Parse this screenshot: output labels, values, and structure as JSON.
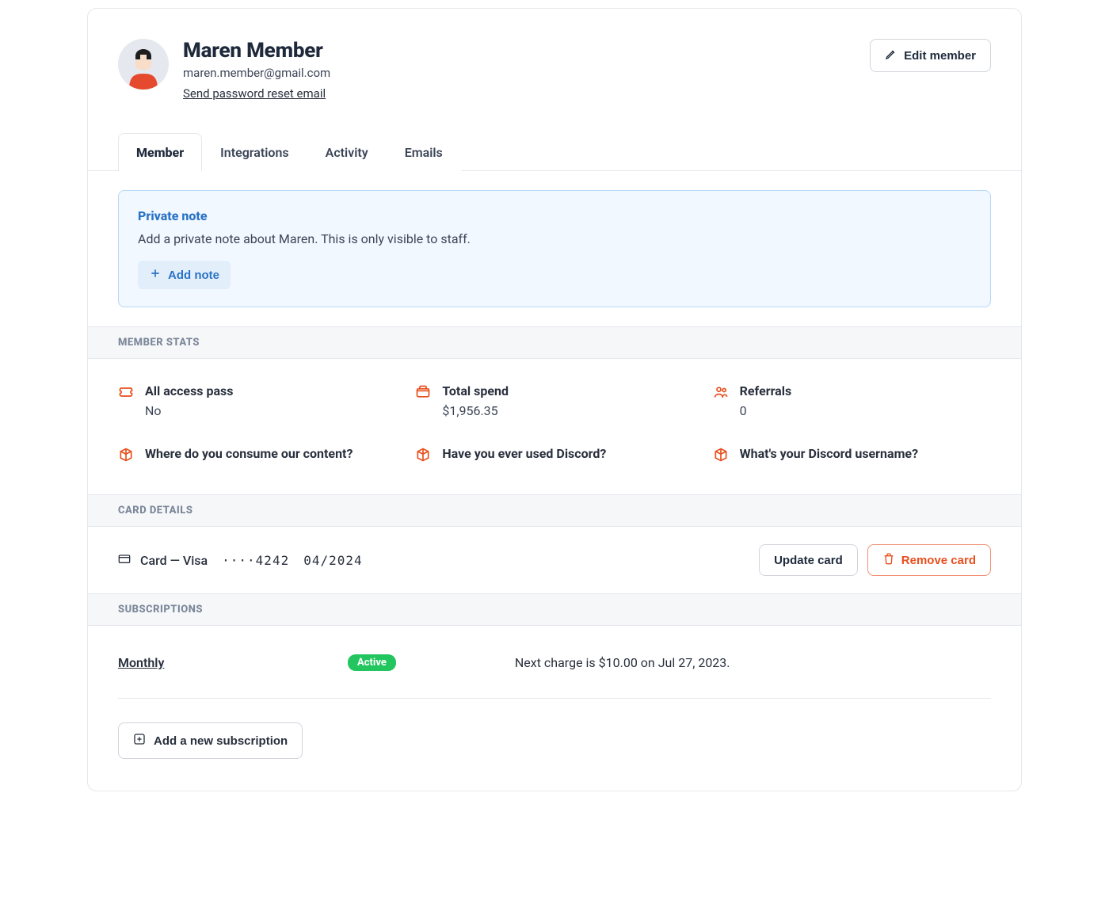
{
  "member": {
    "name": "Maren Member",
    "email": "maren.member@gmail.com",
    "reset_link": "Send password reset email"
  },
  "edit_button": "Edit member",
  "tabs": [
    "Member",
    "Integrations",
    "Activity",
    "Emails"
  ],
  "private_note": {
    "title": "Private note",
    "description": "Add a private note about Maren. This is only visible to staff.",
    "add_label": "Add note"
  },
  "sections": {
    "stats": "MEMBER STATS",
    "card": "CARD DETAILS",
    "subs": "SUBSCRIPTIONS"
  },
  "stats": [
    {
      "icon": "ticket",
      "label": "All access pass",
      "value": "No"
    },
    {
      "icon": "wallet",
      "label": "Total spend",
      "value": "$1,956.35"
    },
    {
      "icon": "users",
      "label": "Referrals",
      "value": "0"
    },
    {
      "icon": "cube",
      "label": "Where do you consume our content?",
      "value": ""
    },
    {
      "icon": "cube",
      "label": "Have you ever used Discord?",
      "value": ""
    },
    {
      "icon": "cube",
      "label": "What's your Discord username?",
      "value": ""
    }
  ],
  "card_details": {
    "text": "Card — Visa",
    "masked": "····4242",
    "expiry": "04/2024",
    "update": "Update card",
    "remove": "Remove card"
  },
  "subscriptions": [
    {
      "name": "Monthly",
      "status": "Active",
      "next_charge": "Next charge is $10.00 on  Jul 27, 2023."
    }
  ],
  "add_subscription": "Add a new subscription"
}
